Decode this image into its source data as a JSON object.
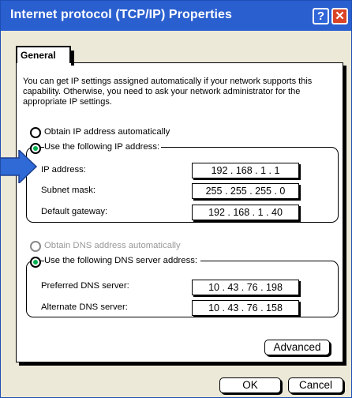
{
  "window": {
    "title": "Internet protocol (TCP/IP) Properties",
    "help_label": "?",
    "close_label": "✕",
    "titlebar_color": "#2a5fd0",
    "close_color": "#d94426"
  },
  "tabs": [
    {
      "label": "General",
      "selected": true
    }
  ],
  "intro_text": "You can get IP settings assigned automatically if your network supports this capability.  Otherwise, you need to ask your network administrator for the appropriate IP settings.",
  "ip_section": {
    "auto_option": {
      "label": "Obtain IP address automatically",
      "selected": false
    },
    "manual_option": {
      "label": "Use the following IP address:",
      "selected": true
    },
    "fields": [
      {
        "label": "IP address:",
        "value": "192 . 168 . 1 . 1"
      },
      {
        "label": "Subnet mask:",
        "value": "255 . 255 . 255 . 0"
      },
      {
        "label": "Default gateway:",
        "value": "192 . 168 . 1 . 40"
      }
    ]
  },
  "dns_section": {
    "auto_option": {
      "label": "Obtain DNS address automatically",
      "selected": false,
      "disabled": true
    },
    "manual_option": {
      "label": "Use the following DNS server address:",
      "selected": true
    },
    "fields": [
      {
        "label": "Preferred DNS server:",
        "value": "10 . 43 . 76 . 198"
      },
      {
        "label": "Alternate DNS server:",
        "value": "10 . 43 . 76 . 158"
      }
    ]
  },
  "buttons": {
    "advanced": "Advanced",
    "ok": "OK",
    "cancel": "Cancel"
  },
  "accent": {
    "radio_dot": "#00b050",
    "pointer_arrow": "#2f6ad6"
  },
  "pointer_icon": "arrow-right-icon"
}
